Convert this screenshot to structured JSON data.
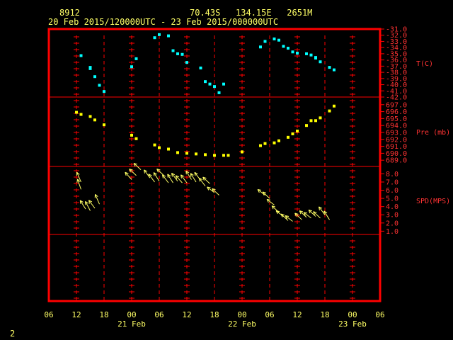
{
  "header": {
    "station": "8912",
    "location": "70.43S   134.15E   2651M",
    "period": "20 Feb 2015/120000UTC - 23 Feb 2015/000000UTC"
  },
  "page_number": "2",
  "colors": {
    "frame": "#ff0000",
    "axis_text": "#ffff66",
    "label_text": "#ff3333",
    "temperature": "#00ffff",
    "pressure": "#ffff00",
    "wind": "#ffff66"
  },
  "chart_data": {
    "type": "scatter",
    "x_axis": {
      "ticks": [
        "06",
        "12",
        "18",
        "00",
        "06",
        "12",
        "18",
        "00",
        "06",
        "12",
        "18",
        "00",
        "06"
      ],
      "tick_hours": [
        -6,
        0,
        6,
        12,
        18,
        24,
        30,
        36,
        42,
        48,
        54,
        60,
        66
      ],
      "day_labels": [
        {
          "label": "21 Feb",
          "hour": 12
        },
        {
          "label": "22 Feb",
          "hour": 36
        },
        {
          "label": "23 Feb",
          "hour": 60
        }
      ],
      "range_hours": [
        -6,
        66
      ]
    },
    "panels": [
      {
        "name": "T(C)",
        "ticks": [
          "-31.0",
          "-32.0",
          "-33.0",
          "-34.0",
          "-35.0",
          "-36.0",
          "-37.0",
          "-38.0",
          "-39.0",
          "-40.0",
          "-41.0",
          "-42.0"
        ],
        "tick_values": [
          -31,
          -32,
          -33,
          -34,
          -35,
          -36,
          -37,
          -38,
          -39,
          -40,
          -41,
          -42
        ],
        "ylim": [
          -42,
          -31
        ],
        "x": [
          1,
          3,
          3,
          4,
          5,
          6,
          12,
          13,
          17,
          18,
          20,
          21,
          22,
          23,
          24,
          27,
          28,
          29,
          30,
          31,
          32,
          40,
          41,
          43,
          44,
          45,
          46,
          47,
          48,
          50,
          51,
          52,
          52,
          53,
          55,
          56
        ],
        "y": [
          -35.3,
          -37.2,
          -37.4,
          -38.7,
          -40.1,
          -41.1,
          -37.1,
          -35.8,
          -32.4,
          -31.9,
          -32.1,
          -34.5,
          -35.0,
          -35.1,
          -36.4,
          -37.3,
          -39.5,
          -39.9,
          -40.3,
          -41.3,
          -39.9,
          -33.9,
          -33.0,
          -32.6,
          -32.8,
          -33.8,
          -34.1,
          -34.7,
          -34.9,
          -35.0,
          -35.2,
          -35.6,
          -35.7,
          -36.3,
          -37.2,
          -37.6
        ]
      },
      {
        "name": "Pre (mb)",
        "ticks": [
          "697.0",
          "696.0",
          "695.0",
          "694.0",
          "693.0",
          "692.0",
          "691.0",
          "690.0",
          "689.0"
        ],
        "tick_values": [
          697,
          696,
          695,
          694,
          693,
          692,
          691,
          690,
          689
        ],
        "ylim": [
          688.1,
          698.1
        ],
        "x": [
          0,
          1,
          3,
          4,
          6,
          12,
          13,
          17,
          18,
          20,
          22,
          24,
          26,
          28,
          30,
          32,
          33,
          36,
          40,
          41,
          43,
          44,
          46,
          47,
          48,
          50,
          51,
          52,
          53,
          55,
          56
        ],
        "y": [
          695.9,
          695.6,
          695.3,
          694.8,
          694.1,
          692.6,
          692.1,
          691.2,
          690.8,
          690.6,
          690.1,
          690.0,
          689.9,
          689.8,
          689.7,
          689.7,
          689.7,
          690.2,
          691.1,
          691.4,
          691.5,
          691.8,
          692.3,
          692.8,
          693.2,
          694.0,
          694.7,
          694.7,
          695.1,
          696.1,
          696.8
        ]
      },
      {
        "name": "SPD(MPS)",
        "ticks": [
          "8.0",
          "7.0",
          "6.0",
          "5.0",
          "4.0",
          "3.0",
          "2.0",
          "1.0"
        ],
        "tick_values": [
          8,
          7,
          6,
          5,
          4,
          3,
          2,
          1
        ],
        "ylim": [
          0.6,
          8.9
        ],
        "x": [
          1,
          1,
          2,
          3,
          4,
          5,
          12,
          13,
          14,
          16,
          17,
          18,
          19,
          20,
          21,
          22,
          23,
          24,
          25,
          26,
          27,
          28,
          29,
          30,
          31,
          41,
          42,
          43,
          44,
          45,
          46,
          47,
          49,
          50,
          51,
          52,
          53,
          54,
          55
        ],
        "y": [
          7.0,
          6.1,
          3.7,
          3.5,
          3.8,
          4.3,
          7.3,
          7.8,
          8.5,
          7.5,
          7.0,
          7.1,
          7.8,
          6.9,
          6.9,
          7.1,
          6.9,
          6.9,
          7.3,
          7.0,
          7.2,
          6.5,
          6.8,
          5.7,
          5.4,
          5.4,
          5.0,
          4.2,
          3.3,
          2.8,
          2.3,
          2.2,
          2.4,
          2.7,
          2.6,
          2.8,
          2.6,
          3.0,
          2.4
        ],
        "dir_deg": [
          30,
          25,
          40,
          35,
          45,
          30,
          50,
          55,
          55,
          45,
          45,
          40,
          55,
          45,
          40,
          45,
          50,
          45,
          40,
          40,
          45,
          45,
          55,
          60,
          55,
          60,
          55,
          60,
          55,
          60,
          55,
          60,
          55,
          55,
          60,
          55,
          55,
          45,
          40
        ]
      }
    ]
  }
}
